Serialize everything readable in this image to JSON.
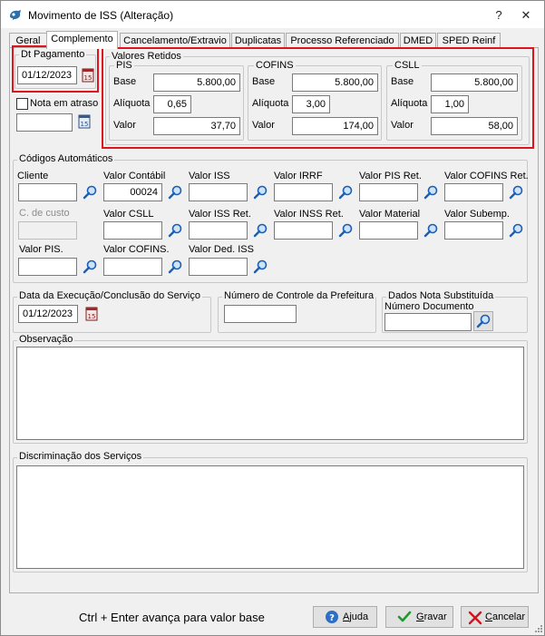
{
  "window": {
    "title": "Movimento de ISS (Alteração)",
    "help_glyph": "?",
    "close_glyph": "✕"
  },
  "tabs": [
    "Geral",
    "Complemento",
    "Cancelamento/Extravio",
    "Duplicatas",
    "Processo Referenciado",
    "DMED",
    "SPED Reinf"
  ],
  "active_tab": "Complemento",
  "dt_pagamento": {
    "label": "Dt Pagamento",
    "value": "01/12/2023"
  },
  "nota_atraso": {
    "label": "Nota em atraso",
    "checked": false,
    "value": ""
  },
  "valores_retidos": {
    "label": "Valores Retidos",
    "labels": {
      "base": "Base",
      "aliquota": "Alíquota",
      "valor": "Valor"
    },
    "pis": {
      "label": "PIS",
      "base": "5.800,00",
      "aliquota": "0,65",
      "valor": "37,70"
    },
    "cofins": {
      "label": "COFINS",
      "base": "5.800,00",
      "aliquota": "3,00",
      "valor": "174,00"
    },
    "csll": {
      "label": "CSLL",
      "base": "5.800,00",
      "aliquota": "1,00",
      "valor": "58,00"
    }
  },
  "codigos": {
    "label": "Códigos Automáticos",
    "cliente": {
      "label": "Cliente",
      "value": ""
    },
    "valor_contabil": {
      "label": "Valor Contábil",
      "value": "00024"
    },
    "valor_iss": {
      "label": "Valor ISS",
      "value": ""
    },
    "valor_irrf": {
      "label": "Valor IRRF",
      "value": ""
    },
    "valor_pis_ret": {
      "label": "Valor PIS Ret.",
      "value": ""
    },
    "valor_cofins_ret": {
      "label": "Valor COFINS Ret.",
      "value": ""
    },
    "c_custo": {
      "label": "C. de custo",
      "value": ""
    },
    "valor_csll": {
      "label": "Valor CSLL",
      "value": ""
    },
    "valor_iss_ret": {
      "label": "Valor ISS Ret.",
      "value": ""
    },
    "valor_inss_ret": {
      "label": "Valor INSS Ret.",
      "value": ""
    },
    "valor_material": {
      "label": "Valor Material",
      "value": ""
    },
    "valor_subemp": {
      "label": "Valor Subemp.",
      "value": ""
    },
    "valor_pis": {
      "label": "Valor PIS.",
      "value": ""
    },
    "valor_cofins": {
      "label": "Valor COFINS.",
      "value": ""
    },
    "valor_ded_iss": {
      "label": "Valor Ded. ISS",
      "value": ""
    }
  },
  "data_execucao": {
    "label": "Data da Execução/Conclusão do Serviço",
    "value": "01/12/2023"
  },
  "num_controle": {
    "label": "Número de Controle da Prefeitura",
    "value": ""
  },
  "nota_substituida": {
    "label": "Dados Nota Substituída",
    "num_label": "Número Documento",
    "value": ""
  },
  "observacao": {
    "label": "Observação",
    "value": ""
  },
  "discriminacao": {
    "label": "Discriminação dos Serviços",
    "value": ""
  },
  "footer": {
    "hint": "Ctrl + Enter avança para valor base",
    "ajuda": {
      "key": "A",
      "rest": "juda"
    },
    "gravar": {
      "key": "G",
      "rest": "ravar"
    },
    "cancelar": {
      "key": "C",
      "rest": "ancelar"
    }
  },
  "colors": {
    "highlight": "#e0141e",
    "accent": "#1b5fb4"
  }
}
